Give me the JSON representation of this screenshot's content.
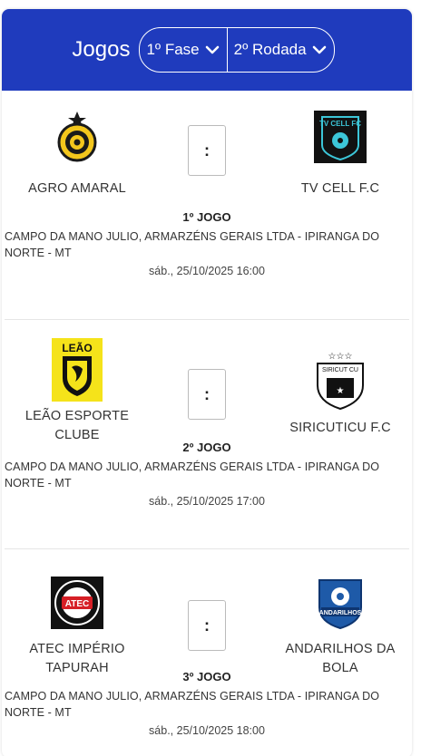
{
  "header": {
    "title": "Jogos",
    "phase": "1º Fase",
    "round": "2º Rodada",
    "color": "#1f3bbd"
  },
  "matches": [
    {
      "home": {
        "name": "AGRO AMARAL",
        "logo": "agro-amaral-logo"
      },
      "away": {
        "name": "TV CELL F.C",
        "logo": "tv-cell-logo"
      },
      "score": ":",
      "game": "1º JOGO",
      "venue": "CAMPO DA MANO JULIO, ARMARZÉNS GERAIS LTDA - IPIRANGA DO NORTE - MT",
      "datetime": "sáb., 25/10/2025 16:00"
    },
    {
      "home": {
        "name": "LEÃO ESPORTE CLUBE",
        "logo": "leao-logo"
      },
      "away": {
        "name": "SIRICUTICU F.C",
        "logo": "siricuticu-logo"
      },
      "score": ":",
      "game": "2º JOGO",
      "venue": "CAMPO DA MANO JULIO, ARMARZÉNS GERAIS LTDA - IPIRANGA DO NORTE - MT",
      "datetime": "sáb., 25/10/2025 17:00"
    },
    {
      "home": {
        "name": "ATEC  IMPÉRIO TAPURAH",
        "logo": "atec-logo"
      },
      "away": {
        "name": "ANDARILHOS DA BOLA",
        "logo": "andarilhos-logo"
      },
      "score": ":",
      "game": "3º JOGO",
      "venue": "CAMPO DA MANO JULIO, ARMARZÉNS GERAIS LTDA - IPIRANGA DO NORTE - MT",
      "datetime": "sáb., 25/10/2025 18:00"
    }
  ],
  "logo_text": {
    "tv_cell": "TV CELL FC",
    "leao": "LEÃO",
    "siricuticu": "SIRICUT CU",
    "atec": "ATEC",
    "andarilhos": "ANDARILHOS"
  }
}
